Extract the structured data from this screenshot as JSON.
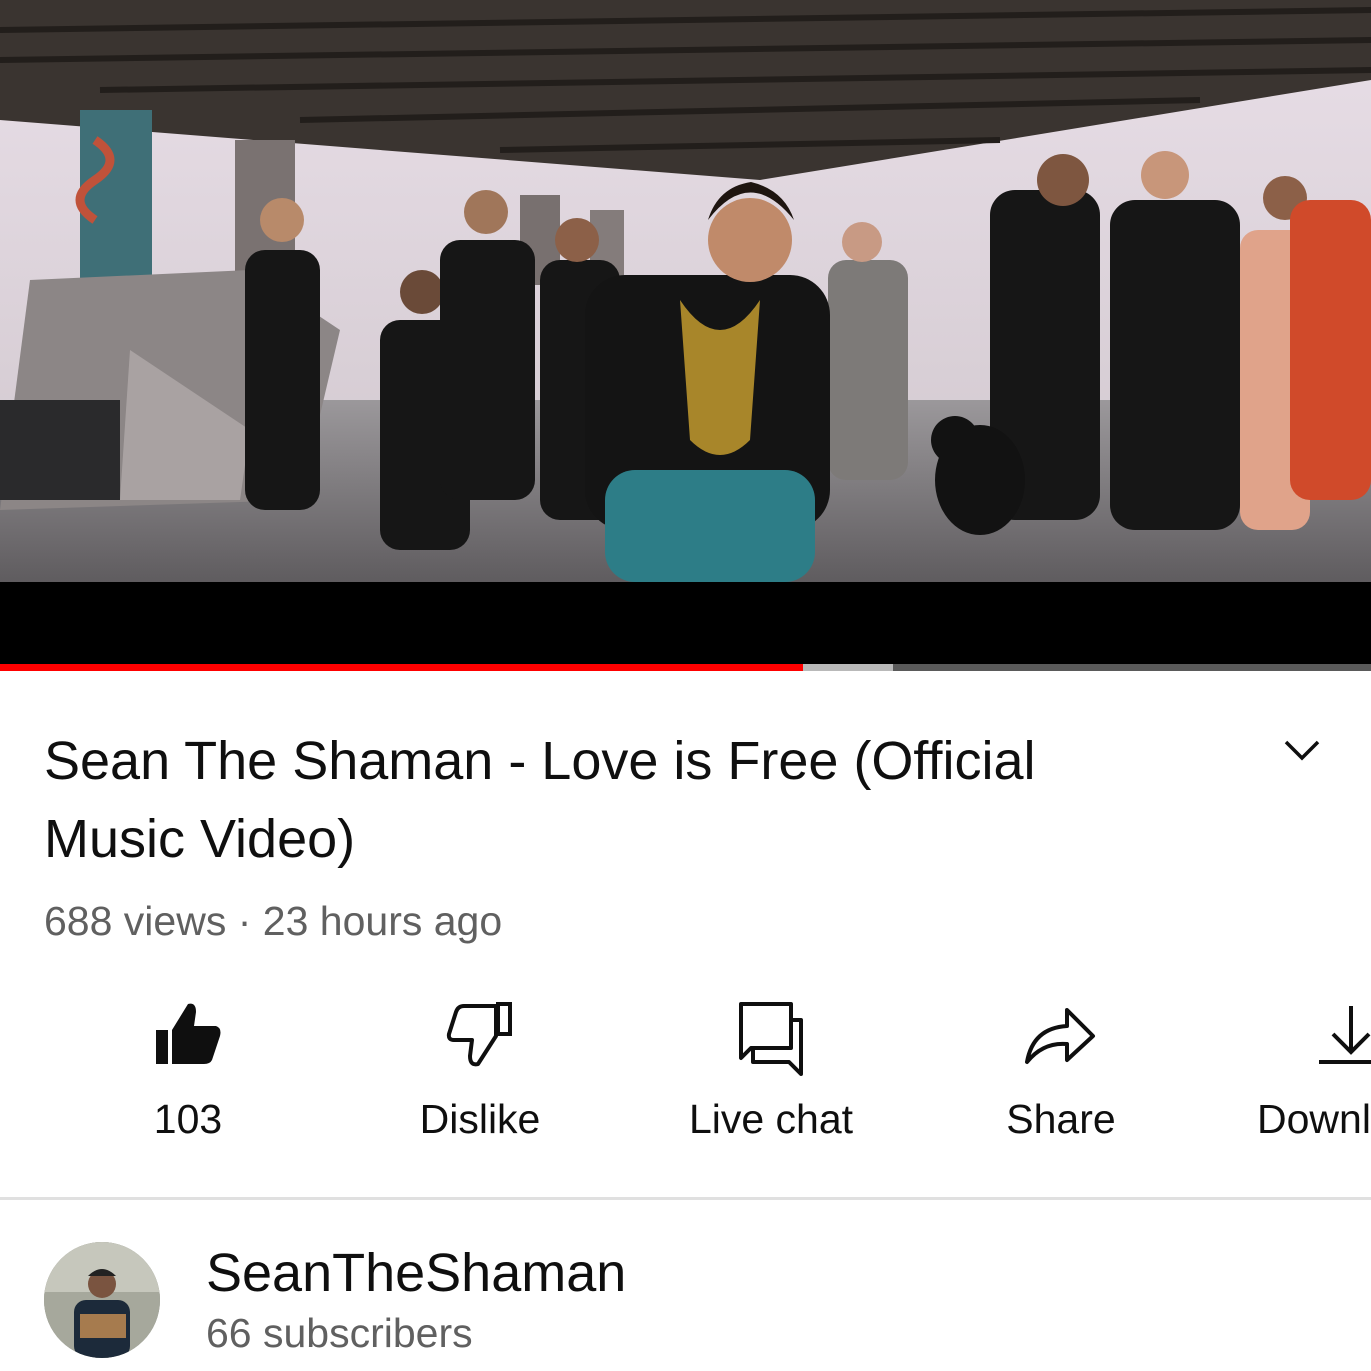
{
  "player": {
    "progress": 0.586,
    "buffered": 0.651,
    "accent_color": "#ff0000"
  },
  "video": {
    "title": "Sean The Shaman - Love is Free  (Official Music Video)",
    "views": "688 views",
    "separator": "·",
    "age": "23 hours ago"
  },
  "actions": [
    {
      "icon": "thumbs-up-icon",
      "label": "103"
    },
    {
      "icon": "thumbs-down-icon",
      "label": "Dislike"
    },
    {
      "icon": "live-chat-icon",
      "label": "Live chat"
    },
    {
      "icon": "share-icon",
      "label": "Share"
    },
    {
      "icon": "download-icon",
      "label": "Downl"
    }
  ],
  "channel": {
    "name": "SeanTheShaman",
    "subscribers": "66 subscribers"
  }
}
